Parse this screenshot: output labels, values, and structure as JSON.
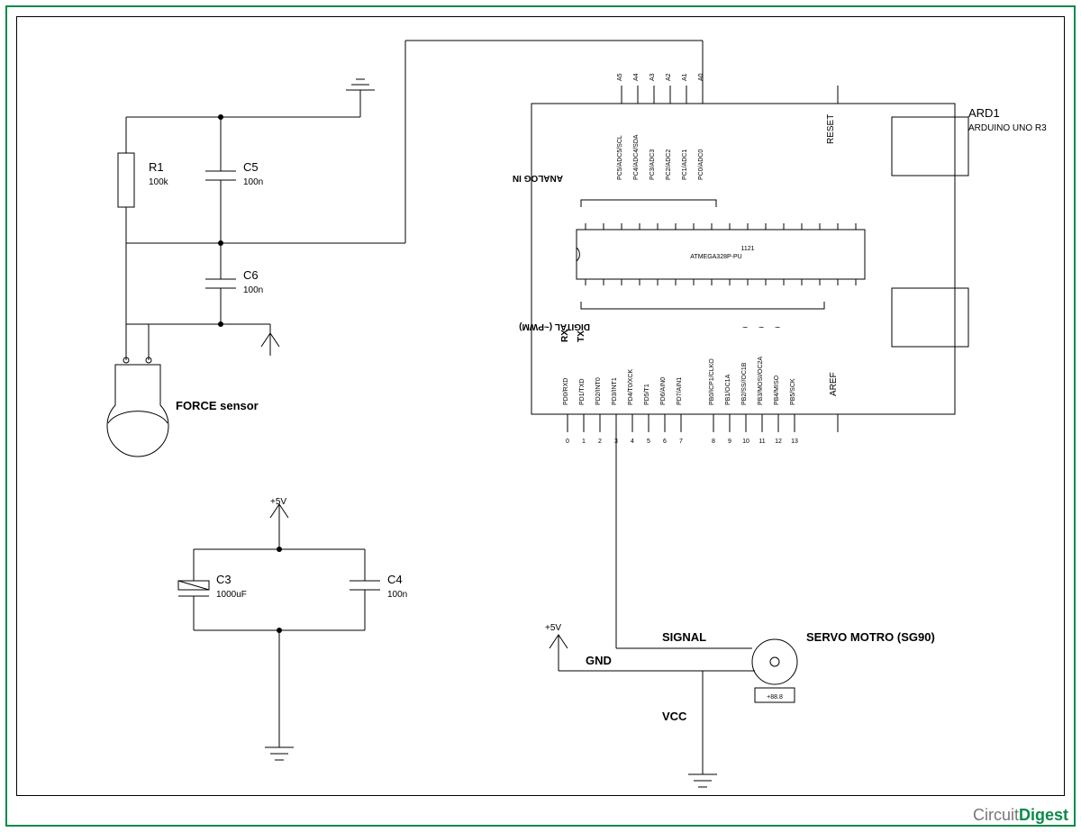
{
  "components": {
    "r1": {
      "ref": "R1",
      "value": "100k"
    },
    "c5": {
      "ref": "C5",
      "value": "100n"
    },
    "c6": {
      "ref": "C6",
      "value": "100n"
    },
    "c3": {
      "ref": "C3",
      "value": "1000uF"
    },
    "c4": {
      "ref": "C4",
      "value": "100n"
    },
    "force_sensor": {
      "label": "FORCE sensor"
    },
    "servo": {
      "label": "SERVO MOTRO (SG90)",
      "reading": "+88.8"
    },
    "arduino": {
      "ref": "ARD1",
      "part": "ARDUINO UNO R3",
      "chip_main": "ATMEGA328P-PU",
      "chip_sub": "1121",
      "analog_header": "ANALOG IN",
      "digital_header": "DIGITAL (~PWM)",
      "rx": "RX",
      "tx": "TX",
      "reset": "RESET",
      "aref": "AREF",
      "analog_top": [
        "A5",
        "A4",
        "A3",
        "A2",
        "A1",
        "A0"
      ],
      "analog_pins": [
        "PC5/ADC5/SCL",
        "PC4/ADC4/SDA",
        "PC3/ADC3",
        "PC2/ADC2",
        "PC1/ADC1",
        "PC0/ADC0"
      ],
      "digital_pins": [
        "PD0/RXD",
        "PD1/TXD",
        "PD2/INT0",
        "PD3/INT1",
        "PD4/T0/XCK",
        "PD5/T1",
        "PD6/AIN0",
        "PD7/AIN1",
        "PB0/ICP1/CLKO",
        "PB1/OC1A",
        "PB2/SS//OC1B",
        "PB3/MOSI/OC2A",
        "PB4/MISO",
        "PB5/SCK"
      ],
      "digital_nums": [
        "0",
        "1",
        "2",
        "3",
        "4",
        "5",
        "6",
        "7",
        "8",
        "9",
        "10",
        "11",
        "12",
        "13"
      ]
    }
  },
  "nets": {
    "five_v_a": "+5V",
    "five_v_b": "+5V",
    "gnd": "GND",
    "vcc": "VCC",
    "signal": "SIGNAL"
  },
  "watermark": {
    "left": "Circuit",
    "right": "Digest"
  }
}
